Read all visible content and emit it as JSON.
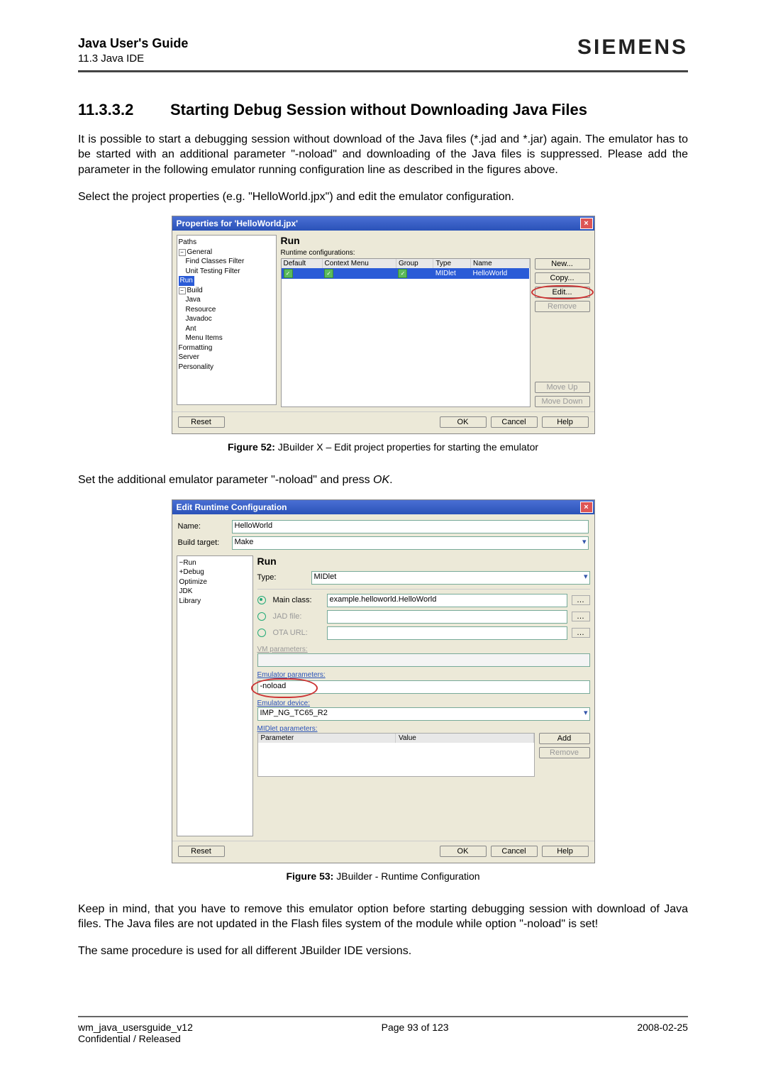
{
  "header": {
    "title": "Java User's Guide",
    "subtitle": "11.3 Java IDE",
    "brand": "SIEMENS"
  },
  "section": {
    "number": "11.3.3.2",
    "title": "Starting Debug Session without Downloading Java Files"
  },
  "para1": "It is possible to start a debugging session without download of the Java files (*.jad and *.jar) again. The emulator has to be started with an additional parameter \"-noload\" and downloading of the Java files is suppressed. Please add the parameter in the following emulator running configuration line as described in the figures above.",
  "para2": "Select the project properties (e.g. \"HelloWorld.jpx\") and edit the emulator configuration.",
  "fig52": {
    "windowTitle": "Properties for 'HelloWorld.jpx'",
    "paneTitle": "Run",
    "runtimeLabel": "Runtime configurations:",
    "cols": {
      "c1": "Default",
      "c2": "Context Menu",
      "c3": "Group",
      "c4": "Type",
      "c5": "Name"
    },
    "row": {
      "type": "MIDlet",
      "name": "HelloWorld"
    },
    "tree": [
      "Paths",
      "General",
      "Find Classes Filter",
      "Unit Testing Filter",
      "Run",
      "Build",
      "Java",
      "Resource",
      "Javadoc",
      "Ant",
      "Menu Items",
      "Formatting",
      "Server",
      "Personality"
    ],
    "btns": {
      "new": "New...",
      "copy": "Copy...",
      "edit": "Edit...",
      "remove": "Remove",
      "moveup": "Move Up",
      "movedown": "Move Down"
    },
    "reset": "Reset",
    "ok": "OK",
    "cancel": "Cancel",
    "help": "Help",
    "caption_b": "Figure 52:",
    "caption": "  JBuilder X – Edit project properties for starting the emulator"
  },
  "para3a": "Set the additional emulator parameter \"-noload\" and press ",
  "para3b": "OK",
  "para3c": ".",
  "fig53": {
    "windowTitle": "Edit Runtime Configuration",
    "nameLabel": "Name:",
    "nameValue": "HelloWorld",
    "buildLabel": "Build target:",
    "buildValue": "Make",
    "tree": [
      "Run",
      "Debug",
      "Optimize",
      "JDK",
      "Library"
    ],
    "paneTitle": "Run",
    "typeLabel": "Type:",
    "typeValue": "MIDlet",
    "mainClass": "Main class:",
    "mainClassVal": "example.helloworld.HelloWorld",
    "jadFile": "JAD file:",
    "otaUrl": "OTA URL:",
    "vmParams": "VM parameters:",
    "emuParams": "Emulator parameters:",
    "emuParamsVal": "-noload",
    "emuDevice": "Emulator device:",
    "emuDeviceVal": "IMP_NG_TC65_R2",
    "midletParams": "MIDlet parameters:",
    "colParam": "Parameter",
    "colValue": "Value",
    "add": "Add",
    "remove": "Remove",
    "reset": "Reset",
    "ok": "OK",
    "cancel": "Cancel",
    "help": "Help",
    "caption_b": "Figure 53:",
    "caption": "  JBuilder - Runtime Configuration"
  },
  "para4": "Keep in mind, that you have to remove this emulator option before starting debugging session with download of Java files. The Java files are not updated in the Flash files system of the module while option \"-noload\" is set!",
  "para5": "The same procedure is used for all different JBuilder IDE versions.",
  "footer": {
    "left1": "wm_java_usersguide_v12",
    "left2": "Confidential / Released",
    "center": "Page 93 of 123",
    "right": "2008-02-25"
  }
}
